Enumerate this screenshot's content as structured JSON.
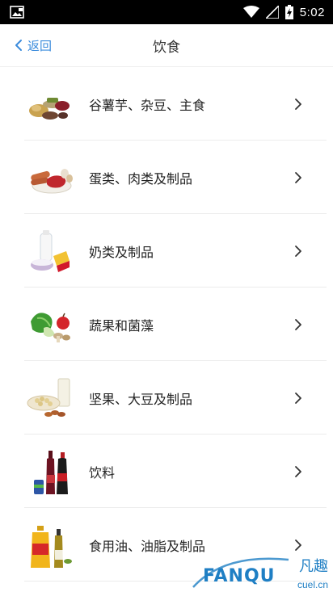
{
  "status_bar": {
    "time": "5:02",
    "icons": [
      "image-icon",
      "wifi-icon",
      "signal-icon",
      "battery-icon"
    ]
  },
  "nav": {
    "back_label": "返回",
    "title": "饮食"
  },
  "categories": [
    {
      "label": "谷薯芋、杂豆、主食",
      "icon": "grains-icon"
    },
    {
      "label": "蛋类、肉类及制品",
      "icon": "meat-eggs-icon"
    },
    {
      "label": "奶类及制品",
      "icon": "dairy-icon"
    },
    {
      "label": "蔬果和菌藻",
      "icon": "vegetables-fruit-icon"
    },
    {
      "label": "坚果、大豆及制品",
      "icon": "nuts-soy-icon"
    },
    {
      "label": "饮料",
      "icon": "beverages-icon"
    },
    {
      "label": "食用油、油脂及制品",
      "icon": "cooking-oil-icon"
    }
  ],
  "watermark": {
    "brand": "FANQU",
    "chinese": "凡趣",
    "domain": "cuel.cn"
  },
  "colors": {
    "accent": "#3a8bdc",
    "status_bar": "#000000",
    "watermark": "#1f7fc4"
  }
}
